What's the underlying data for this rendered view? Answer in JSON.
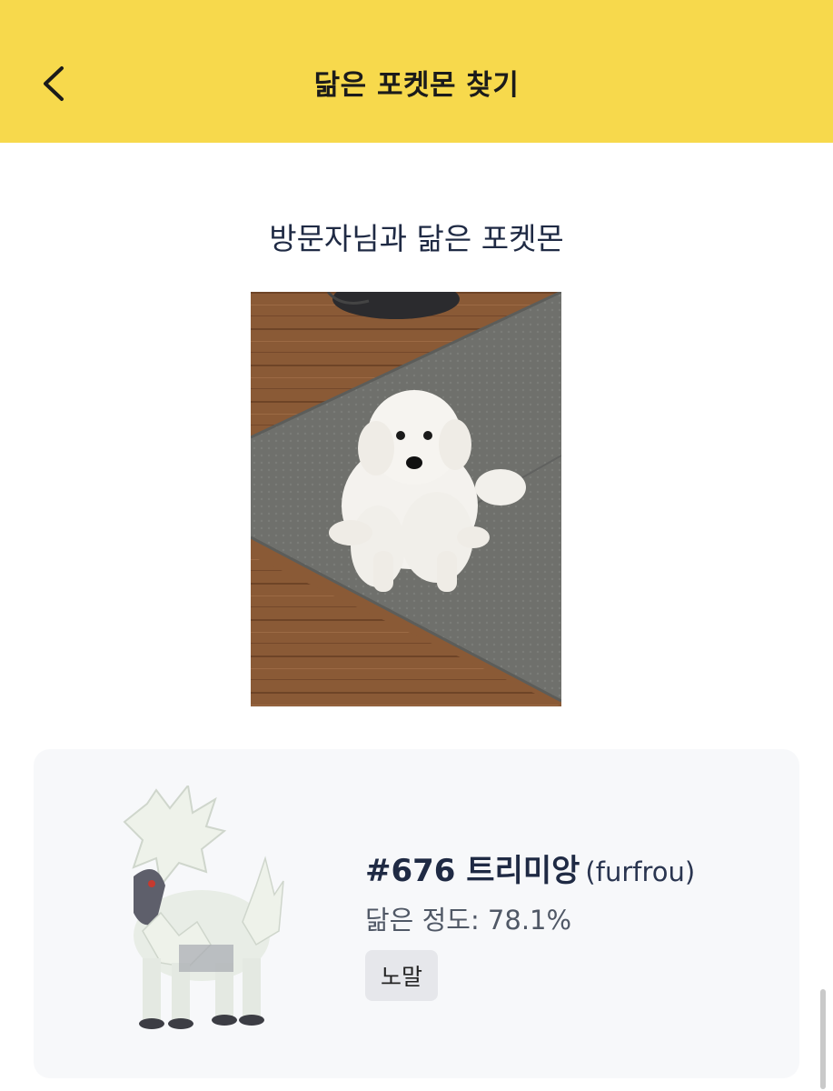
{
  "header": {
    "title": "닮은 포켓몬 찾기",
    "back_icon": "chevron-left-icon"
  },
  "main": {
    "section_title": "방문자님과 닮은 포켓몬"
  },
  "result": {
    "number_name": "#676 트리미앙",
    "english_name": "(furfrou)",
    "similarity": "닮은 정도: 78.1%",
    "type": "노말"
  },
  "colors": {
    "header_bg": "#f7d94c",
    "title_text": "#1f2a44",
    "card_bg": "#f7f8fa",
    "badge_bg": "#e6e7eb"
  }
}
